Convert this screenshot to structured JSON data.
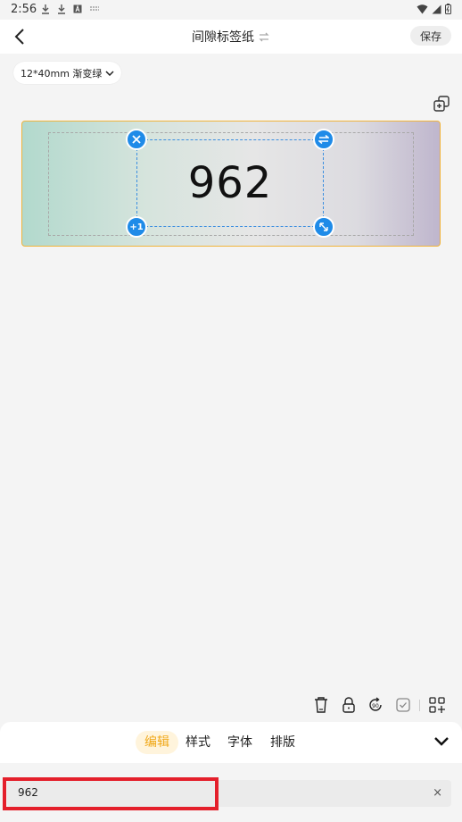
{
  "status_bar": {
    "time": "2:56"
  },
  "header": {
    "title": "间隙标签纸",
    "save_label": "保存"
  },
  "paper": {
    "chip_label": "12*40mm 渐变绿"
  },
  "label": {
    "text": "962"
  },
  "tabs": [
    {
      "label": "编辑",
      "active": true
    },
    {
      "label": "样式",
      "active": false
    },
    {
      "label": "字体",
      "active": false
    },
    {
      "label": "排版",
      "active": false
    }
  ],
  "input": {
    "value": "962",
    "clear_symbol": "×"
  },
  "colors": {
    "accent": "#1f8be8",
    "active_tab_text": "#f0a818",
    "canvas_border": "#f0b43c",
    "highlight": "#e41f2b"
  },
  "icons": {
    "delete_handle": "close-icon",
    "swap_handle": "swap-icon",
    "plus_one_handle": "plus-one-icon",
    "resize_handle": "resize-icon",
    "tools": [
      "trash-icon",
      "lock-icon",
      "rotate-icon",
      "checkbox-icon",
      "grid-plus-icon"
    ]
  }
}
